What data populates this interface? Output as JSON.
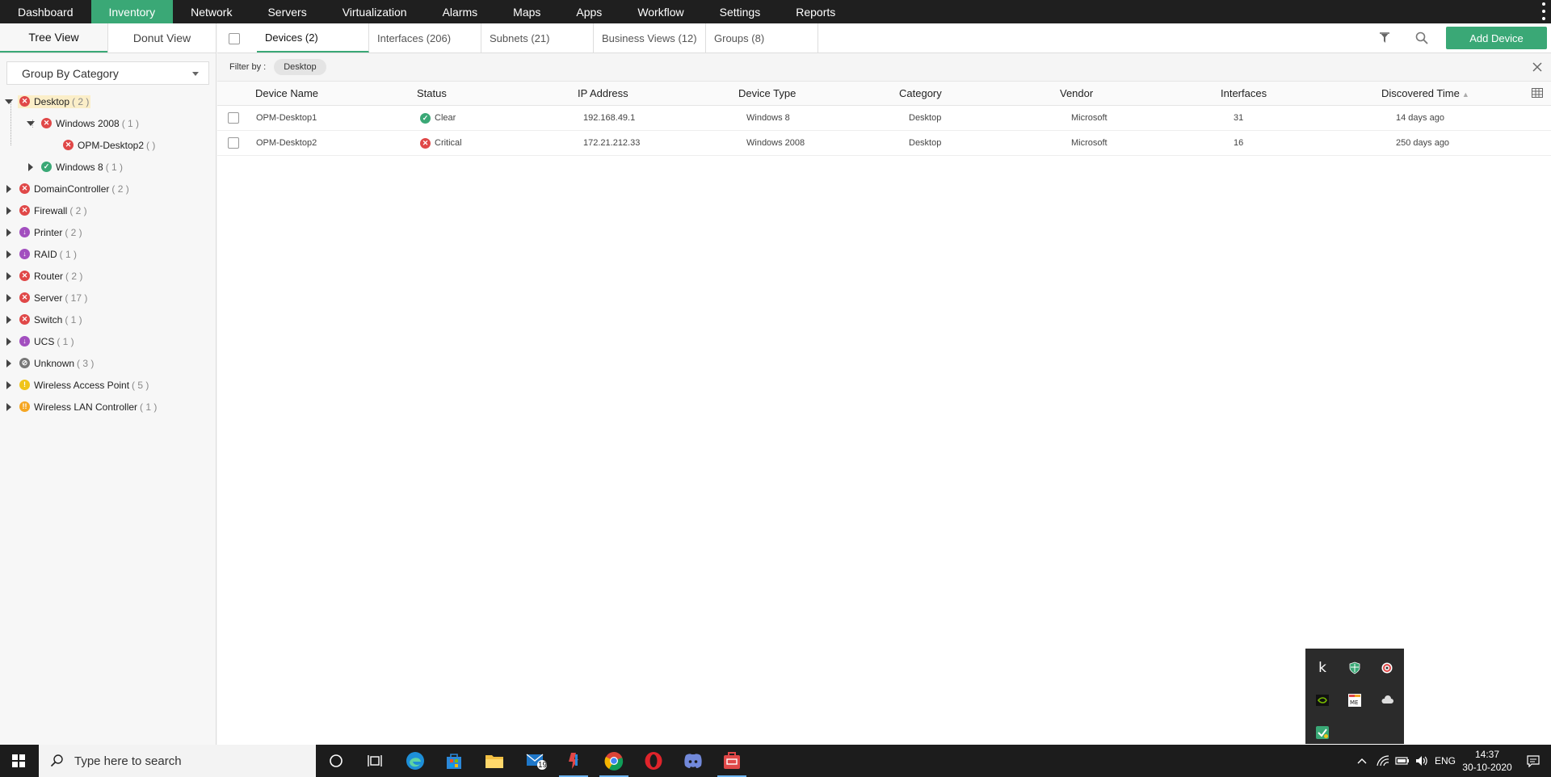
{
  "topnav": {
    "items": [
      "Dashboard",
      "Inventory",
      "Network",
      "Servers",
      "Virtualization",
      "Alarms",
      "Maps",
      "Apps",
      "Workflow",
      "Settings",
      "Reports"
    ],
    "active": "Inventory"
  },
  "left": {
    "view_tabs": [
      "Tree View",
      "Donut View"
    ],
    "group_by": "Group By Category",
    "tree": [
      {
        "label": "Desktop",
        "count": "( 2 )",
        "status": "critical",
        "expanded": true
      },
      {
        "label": "Windows 2008",
        "count": "( 1 )",
        "status": "critical",
        "expanded": true
      },
      {
        "label": "OPM-Desktop2",
        "count": "( )",
        "status": "critical"
      },
      {
        "label": "Windows 8",
        "count": "( 1 )",
        "status": "clear"
      },
      {
        "label": "DomainController",
        "count": "( 2 )",
        "status": "critical"
      },
      {
        "label": "Firewall",
        "count": "( 2 )",
        "status": "critical"
      },
      {
        "label": "Printer",
        "count": "( 2 )",
        "status": "down"
      },
      {
        "label": "RAID",
        "count": "( 1 )",
        "status": "down"
      },
      {
        "label": "Router",
        "count": "( 2 )",
        "status": "critical"
      },
      {
        "label": "Server",
        "count": "( 17 )",
        "status": "critical"
      },
      {
        "label": "Switch",
        "count": "( 1 )",
        "status": "critical"
      },
      {
        "label": "UCS",
        "count": "( 1 )",
        "status": "down"
      },
      {
        "label": "Unknown",
        "count": "( 3 )",
        "status": "unknown"
      },
      {
        "label": "Wireless Access Point",
        "count": "( 5 )",
        "status": "warning"
      },
      {
        "label": "Wireless LAN Controller",
        "count": "( 1 )",
        "status": "attention"
      }
    ]
  },
  "tabs": [
    {
      "label": "Devices",
      "count": "(2)"
    },
    {
      "label": "Interfaces",
      "count": "(206)"
    },
    {
      "label": "Subnets",
      "count": "(21)"
    },
    {
      "label": "Business Views",
      "count": "(12)"
    },
    {
      "label": "Groups",
      "count": "(8)"
    }
  ],
  "add_device_label": "Add Device",
  "filter": {
    "label": "Filter by :",
    "chip": "Desktop"
  },
  "table": {
    "columns": [
      "Device Name",
      "Status",
      "IP Address",
      "Device Type",
      "Category",
      "Vendor",
      "Interfaces",
      "Discovered Time"
    ],
    "rows": [
      {
        "name": "OPM-Desktop1",
        "status": "Clear",
        "status_kind": "clear",
        "ip": "192.168.49.1",
        "type": "Windows 8",
        "category": "Desktop",
        "vendor": "Microsoft",
        "interfaces": "31",
        "discovered": "14 days ago"
      },
      {
        "name": "OPM-Desktop2",
        "status": "Critical",
        "status_kind": "critical",
        "ip": "172.21.212.33",
        "type": "Windows 2008",
        "category": "Desktop",
        "vendor": "Microsoft",
        "interfaces": "16",
        "discovered": "250 days ago"
      }
    ]
  },
  "taskbar": {
    "search_placeholder": "Type here to search",
    "mail_badge": "19",
    "lang": "ENG",
    "time": "14:37",
    "date": "30-10-2020"
  },
  "colors": {
    "accent": "#3aa876",
    "critical": "#e04848",
    "down": "#a24fbf",
    "warning": "#f0c419",
    "attention": "#f5a623",
    "nav_bg": "#1f1f1f"
  }
}
